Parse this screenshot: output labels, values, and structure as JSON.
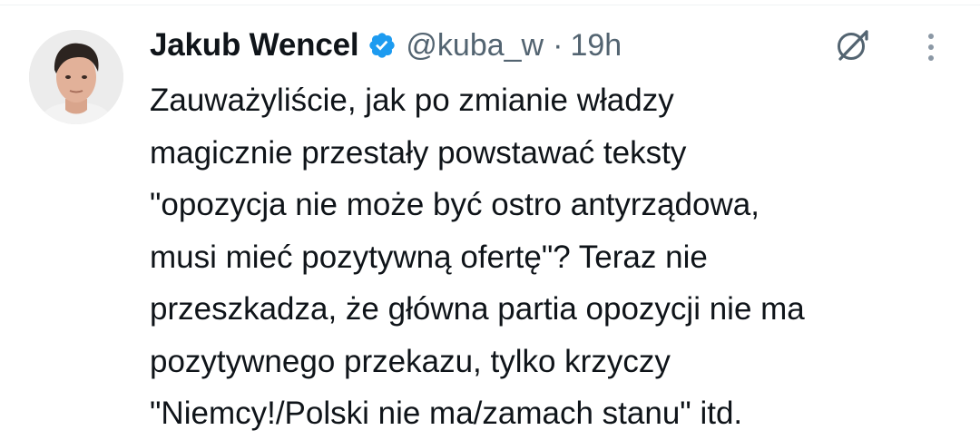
{
  "author": {
    "name": "Jakub Wencel",
    "handle": "@kuba_w",
    "separator": "·",
    "time": "19h",
    "verified": true
  },
  "tweet": {
    "lines": [
      "Zauważyliście, jak po zmianie władzy",
      "magicznie przestały powstawać teksty",
      "\"opozycja nie może być ostro antyrządowa,",
      "musi mieć pozytywną ofertę\"? Teraz nie",
      "przeszkadza, że główna partia opozycji nie ma",
      "pozytywnego przekazu, tylko krzyczy",
      "\"Niemcy!/Polski nie ma/zamach stanu\" itd."
    ]
  },
  "icons": {
    "verified": "verified-badge-icon",
    "grok": "grok-icon",
    "more": "more-options-icon"
  },
  "colors": {
    "text": "#0f1419",
    "secondary": "#536471",
    "verified": "#1d9bf0"
  }
}
